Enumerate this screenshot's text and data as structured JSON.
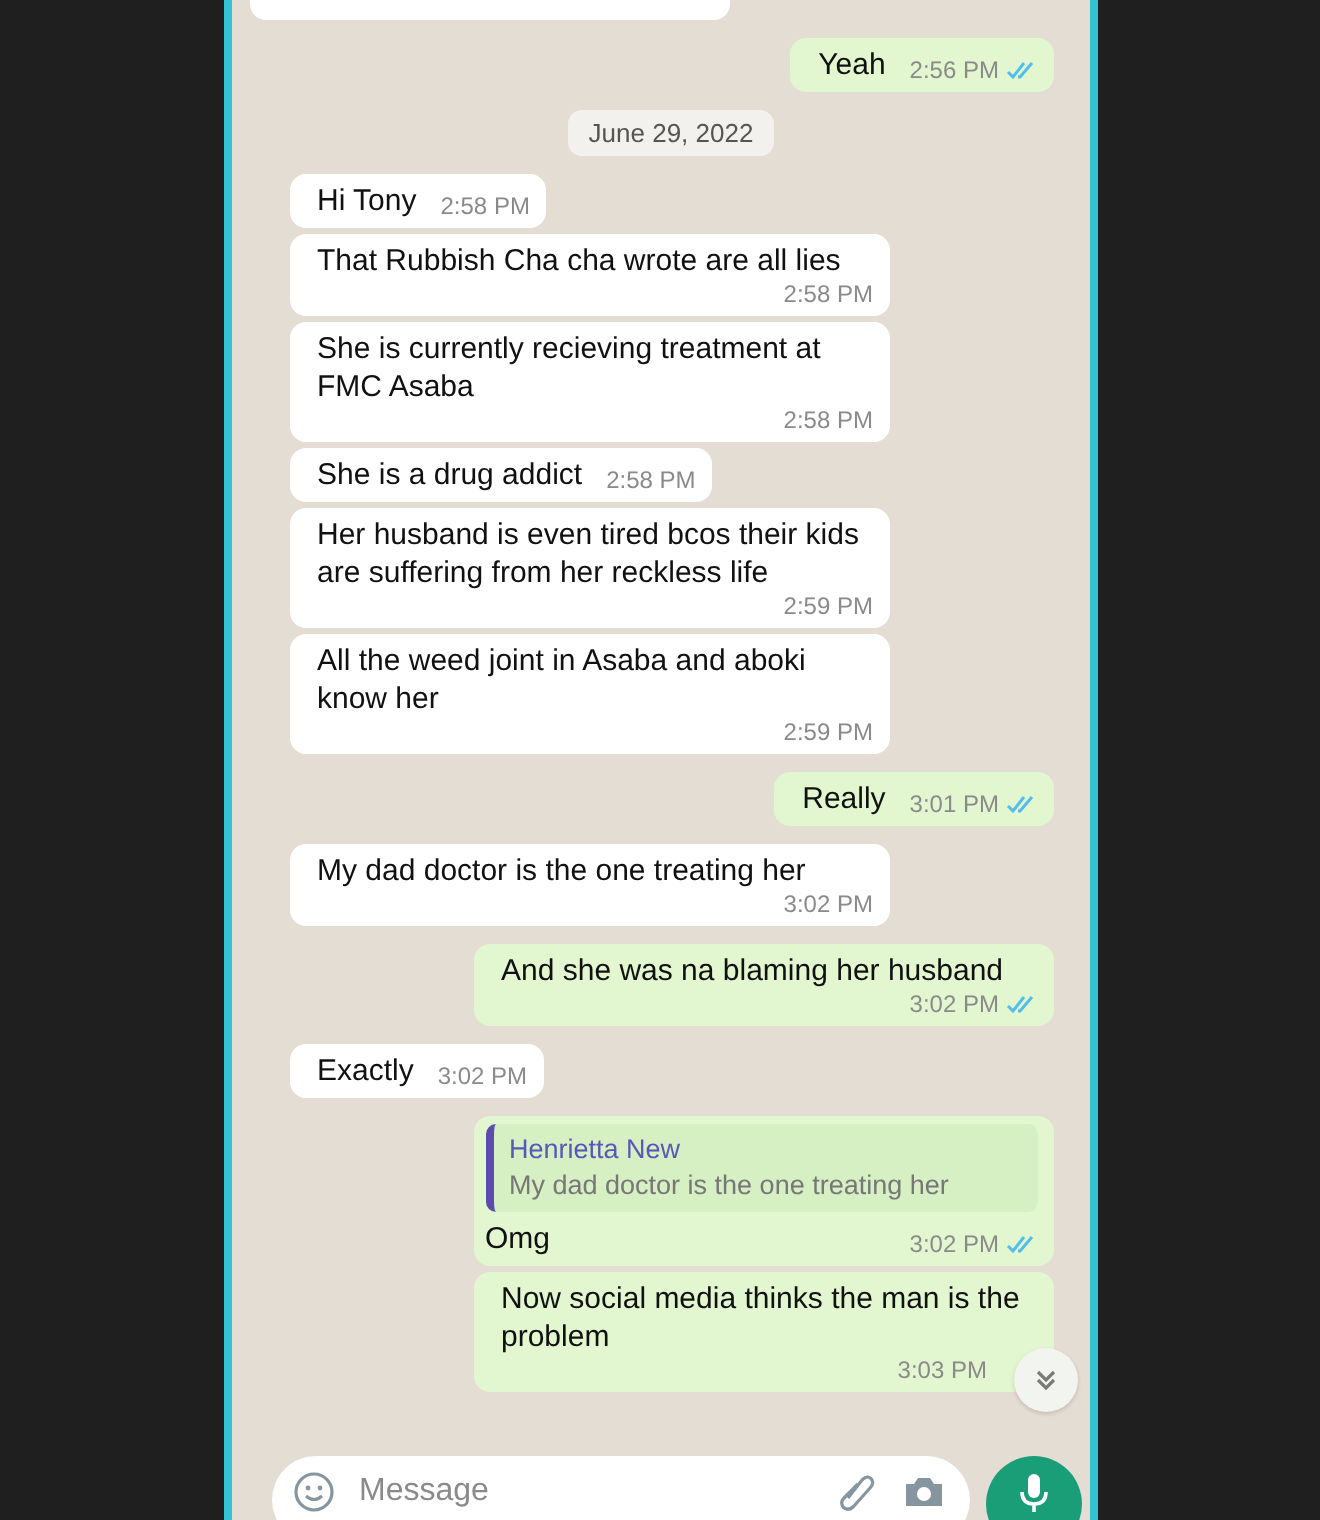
{
  "messages": [
    {
      "kind": "partial"
    },
    {
      "kind": "outgoing",
      "text": "Yeah",
      "time": "2:56 PM",
      "read": true
    },
    {
      "kind": "date",
      "text": "June 29, 2022"
    },
    {
      "kind": "incoming",
      "text": "Hi Tony",
      "time": "2:58 PM"
    },
    {
      "kind": "incoming",
      "text": "That Rubbish Cha cha wrote are all lies",
      "time": "2:58 PM"
    },
    {
      "kind": "incoming",
      "text": "She is currently recieving treatment at FMC Asaba",
      "time": "2:58 PM"
    },
    {
      "kind": "incoming",
      "text": "She is a drug addict",
      "time": "2:58 PM"
    },
    {
      "kind": "incoming",
      "text": "Her husband is even tired bcos their kids are suffering from her reckless life",
      "time": "2:59 PM"
    },
    {
      "kind": "incoming",
      "text": "All the weed joint in Asaba and aboki know her",
      "time": "2:59 PM"
    },
    {
      "kind": "outgoing",
      "text": "Really",
      "time": "3:01 PM",
      "read": true
    },
    {
      "kind": "incoming",
      "text": "My dad doctor is the one treating her",
      "time": "3:02 PM"
    },
    {
      "kind": "outgoing",
      "text": "And she was na blaming her husband",
      "time": "3:02 PM",
      "read": true
    },
    {
      "kind": "incoming",
      "text": "Exactly",
      "time": "3:02 PM"
    },
    {
      "kind": "reply",
      "quote_name": "Henrietta New",
      "quote_text": "My dad doctor is the one treating her",
      "text": "Omg",
      "time": "3:02 PM",
      "read": true
    },
    {
      "kind": "outgoing",
      "text": "Now social media thinks the man is the problem",
      "time": "3:03 PM",
      "read": false
    }
  ],
  "composer": {
    "placeholder": "Message"
  }
}
